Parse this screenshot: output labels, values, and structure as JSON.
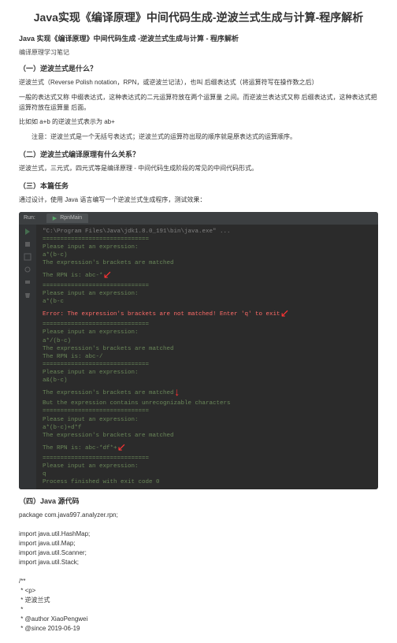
{
  "title": "Java实现《编译原理》中间代码生成-逆波兰式生成与计算-程序解析",
  "subtitle": "Java 实现《编译原理》中间代码生成 -逆波兰式生成与计算 - 程序解析",
  "note": "编译原理学习笔记",
  "s1": {
    "h": "（一）逆波兰式是什么？",
    "p1": "逆波兰式（Reverse Polish notation，RPN，或逆波兰记法），也叫 后缀表达式（将运算符写在操作数之后）",
    "p2": "一般的表达式又称 中缀表达式，这种表达式的二元运算符放在两个运算量 之间。而逆波兰表达式又称 后缀表达式，这种表达式把运算符放在运算量 后面。",
    "p3": "比如如 a+b 的逆波兰式表示为 ab+",
    "p4": "注意：逆波兰式是一个无括号表达式；逆波兰式的运算符出现的顺序就是原表达式的运算顺序。"
  },
  "s2": {
    "h": "（二）逆波兰式编译原理有什么关系？",
    "p1": "逆波兰式，三元式，四元式等是编译原理 - 中间代码生成阶段的常见的中间代码形式。"
  },
  "s3": {
    "h": "（三）本篇任务",
    "p1": "通过设计，使用 Java 语言编写一个逆波兰式生成程序，测试效果："
  },
  "term": {
    "runLabel": "Run:",
    "tab": "RpnMain",
    "lines": [
      {
        "cls": "t-gray",
        "txt": "\"C:\\Program Files\\Java\\jdk1.8.0_191\\bin\\java.exe\" ..."
      },
      {
        "cls": "t-green",
        "txt": "=============================="
      },
      {
        "cls": "t-green",
        "txt": "Please input an expression:"
      },
      {
        "cls": "t-green",
        "txt": "a*(b-c)"
      },
      {
        "cls": "t-green",
        "txt": "The expression's brackets are matched"
      },
      {
        "cls": "t-green",
        "txt": "The RPN is: abc-*",
        "arrow": "↙"
      },
      {
        "cls": "t-green",
        "txt": "=============================="
      },
      {
        "cls": "t-green",
        "txt": "Please input an expression:"
      },
      {
        "cls": "t-green",
        "txt": "a*(b-c"
      },
      {
        "cls": "t-err",
        "txt": "Error: The expression's brackets are not matched! Enter 'q' to exit",
        "arrow": "↙"
      },
      {
        "cls": "t-green",
        "txt": "=============================="
      },
      {
        "cls": "t-green",
        "txt": "Please input an expression:"
      },
      {
        "cls": "t-green",
        "txt": "a*/(b-c)"
      },
      {
        "cls": "t-green",
        "txt": "The expression's brackets are matched"
      },
      {
        "cls": "t-green",
        "txt": "The RPN is: abc-/"
      },
      {
        "cls": "t-green",
        "txt": "=============================="
      },
      {
        "cls": "t-green",
        "txt": "Please input an expression:"
      },
      {
        "cls": "t-green",
        "txt": "a&(b-c)"
      },
      {
        "cls": "t-green",
        "txt": "The expression's brackets are matched",
        "arrow": "↓"
      },
      {
        "cls": "t-green",
        "txt": "But the expression contains unrecognizable characters"
      },
      {
        "cls": "t-green",
        "txt": "=============================="
      },
      {
        "cls": "t-green",
        "txt": "Please input an expression:"
      },
      {
        "cls": "t-green",
        "txt": "a*(b-c)+d*f"
      },
      {
        "cls": "t-green",
        "txt": "The expression's brackets are matched"
      },
      {
        "cls": "t-green",
        "txt": "The RPN is: abc-*df*+",
        "arrow": "↙"
      },
      {
        "cls": "t-green",
        "txt": "=============================="
      },
      {
        "cls": "t-green",
        "txt": "Please input an expression:"
      },
      {
        "cls": "t-green",
        "txt": "q"
      },
      {
        "cls": "t-green",
        "txt": ""
      },
      {
        "cls": "t-green",
        "txt": "Process finished with exit code 0"
      }
    ]
  },
  "s4": {
    "h": "（四）Java 源代码",
    "code": [
      "package com.java997.analyzer.rpn;",
      "",
      "import java.util.HashMap;",
      "import java.util.Map;",
      "import java.util.Scanner;",
      "import java.util.Stack;",
      "",
      "/**",
      " * <p>",
      " * 逆波兰式",
      " *",
      " * @author XiaoPengwei",
      " * @since 2019-06-19"
    ]
  }
}
